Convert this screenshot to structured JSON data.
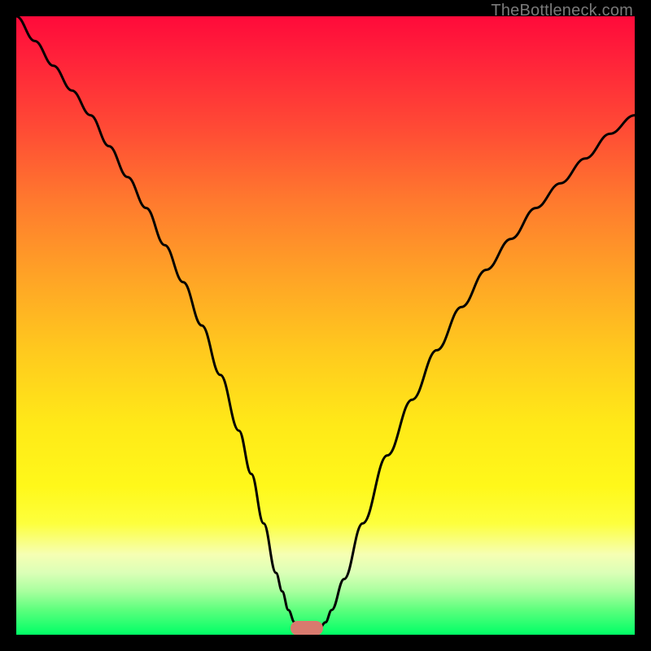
{
  "watermark": "TheBottleneck.com",
  "marker": {
    "x_pct": 47,
    "y_pct": 99
  },
  "colors": {
    "frame": "#000000",
    "curve": "#000000",
    "marker": "#d97a6e",
    "gradient_top": "#ff0a3a",
    "gradient_bottom": "#00ff66",
    "watermark": "#7a7a7a"
  },
  "chart_data": {
    "type": "line",
    "title": "",
    "xlabel": "",
    "ylabel": "",
    "xlim": [
      0,
      100
    ],
    "ylim": [
      0,
      100
    ],
    "grid": false,
    "legend": false,
    "series": [
      {
        "name": "bottleneck-curve",
        "x": [
          0,
          3,
          6,
          9,
          12,
          15,
          18,
          21,
          24,
          27,
          30,
          33,
          36,
          38,
          40,
          42,
          43,
          44,
          45,
          46,
          47,
          48,
          49,
          50,
          51,
          53,
          56,
          60,
          64,
          68,
          72,
          76,
          80,
          84,
          88,
          92,
          96,
          100
        ],
        "y": [
          100,
          96,
          92,
          88,
          84,
          79,
          74,
          69,
          63,
          57,
          50,
          42,
          33,
          26,
          18,
          10,
          7,
          4,
          2,
          1,
          1,
          1,
          1,
          2,
          4,
          9,
          18,
          29,
          38,
          46,
          53,
          59,
          64,
          69,
          73,
          77,
          81,
          84
        ]
      }
    ],
    "annotations": [
      {
        "type": "optimum-marker",
        "x": 47,
        "y": 1
      }
    ]
  }
}
